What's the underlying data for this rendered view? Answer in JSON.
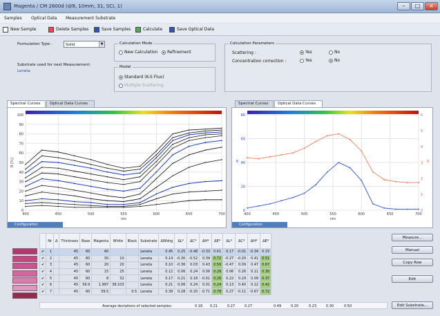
{
  "window": {
    "title": "Magenta / CM 2600d (d/8, 10mm, 31, SCI, 1)"
  },
  "menu": [
    "Samples",
    "Optical Data",
    "Measurement Substrate"
  ],
  "toolbar": {
    "new": "New Sample",
    "delete": "Delete Samples",
    "save": "Save Samples",
    "calculate": "Calculate",
    "save_optical": "Save Optical Data"
  },
  "form": {
    "formulation_label": "Formulation Type :",
    "formulation_value": "Solid",
    "substrate_label": "Substrate used for next Measurement:",
    "substrate_value": "Leneta",
    "calc_mode_title": "Calculation Mode",
    "calc_new": "New Calculation",
    "calc_refine": "Refinement",
    "model_title": "Model",
    "model_standard": "Standard (K-S Flux)",
    "model_other": "Multiple Scattering",
    "params_title": "Calculation Parameters",
    "scattering": "Scattering :",
    "concentration": "Concentration correction :",
    "yes": "Yes",
    "no": "No"
  },
  "left_tabs": [
    "Spectral Curves",
    "Optical Data Curves"
  ],
  "right_tabs": [
    "Spectral Curves",
    "Optical Data Curves"
  ],
  "config_label": "Configuration",
  "left_chart": {
    "ylabel": "R [%]",
    "xlabel": "nm",
    "yticks": [
      "0",
      "10",
      "20",
      "30",
      "40",
      "50",
      "60",
      "70",
      "80",
      "90",
      "100"
    ],
    "xticks": [
      "400",
      "450",
      "500",
      "550",
      "600",
      "650",
      "700"
    ]
  },
  "right_chart": {
    "ylabel": "K",
    "ylabel2": "S",
    "xlabel": "nm",
    "yticks": [
      "0",
      "20",
      "40",
      "60",
      "80"
    ],
    "y2ticks": [
      "0",
      "1",
      "2",
      "3",
      "4",
      "5",
      "6"
    ],
    "xticks": [
      "400",
      "450",
      "500",
      "550",
      "600",
      "650",
      "700"
    ]
  },
  "chart_data": [
    {
      "type": "line",
      "xlabel": "nm",
      "ylabel": "R [%]",
      "xlim": [
        400,
        700
      ],
      "ylim": [
        0,
        100
      ],
      "x": [
        400,
        425,
        450,
        475,
        500,
        525,
        550,
        575,
        600,
        625,
        650,
        675,
        700
      ],
      "series": [
        {
          "values": [
            48,
            63,
            61,
            57,
            53,
            48,
            44,
            46,
            62,
            80,
            84,
            85,
            86
          ]
        },
        {
          "values": [
            43,
            57,
            55,
            52,
            48,
            44,
            41,
            43,
            58,
            76,
            81,
            83,
            84
          ]
        },
        {
          "values": [
            39,
            51,
            50,
            47,
            44,
            40,
            37,
            39,
            55,
            73,
            79,
            81,
            82
          ]
        },
        {
          "values": [
            34,
            45,
            44,
            41,
            38,
            35,
            32,
            35,
            51,
            69,
            76,
            79,
            80
          ]
        },
        {
          "values": [
            30,
            39,
            38,
            35,
            32,
            29,
            27,
            30,
            47,
            65,
            73,
            76,
            78
          ]
        },
        {
          "values": [
            25,
            33,
            31,
            28,
            25,
            22,
            20,
            23,
            40,
            58,
            67,
            71,
            73
          ]
        },
        {
          "values": [
            20,
            26,
            24,
            21,
            18,
            15,
            13,
            17,
            33,
            49,
            58,
            63,
            66
          ]
        },
        {
          "values": [
            15,
            19,
            17,
            15,
            12,
            10,
            9,
            12,
            24,
            36,
            45,
            50,
            53
          ]
        },
        {
          "values": [
            10,
            12,
            11,
            9,
            8,
            6,
            6,
            8,
            17,
            24,
            28,
            30,
            31
          ]
        },
        {
          "values": [
            7,
            8,
            7,
            6,
            5,
            4,
            4,
            6,
            12,
            17,
            19,
            20,
            21
          ]
        },
        {
          "values": [
            4,
            5,
            4,
            3,
            3,
            3,
            3,
            4,
            6,
            8,
            10,
            11,
            11
          ]
        }
      ]
    },
    {
      "type": "line",
      "xlabel": "nm",
      "ylabel": "K",
      "xlim": [
        400,
        700
      ],
      "ylim": [
        0,
        90
      ],
      "x": [
        400,
        420,
        440,
        460,
        480,
        500,
        520,
        540,
        560,
        580,
        600,
        620,
        640,
        660,
        680,
        700
      ],
      "series": [
        {
          "name": "K",
          "values": [
            2,
            4,
            6,
            9,
            12,
            16,
            24,
            36,
            45,
            40,
            28,
            6,
            2,
            1,
            1,
            1
          ]
        },
        {
          "name": "S",
          "values": [
            5.5,
            5.4,
            5.6,
            5.8,
            6.0,
            6.5,
            7.2,
            7.8,
            8.0,
            7.4,
            6.2,
            4.0,
            3.2,
            3.0,
            2.9,
            2.9
          ]
        }
      ]
    }
  ],
  "table": {
    "headers": [
      "",
      "Nr",
      "Δ",
      "Thickness",
      "Base",
      "Magenta",
      "White",
      "Black",
      "Substrate",
      "ΔWdng",
      "ΔL*",
      "ΔC*",
      "ΔH*",
      "ΔE*",
      "ΔL*",
      "ΔC*",
      "ΔH*",
      "ΔE*"
    ],
    "rows": [
      {
        "nr": "1",
        "thick": "45",
        "base": "60",
        "mag": "40",
        "white": "",
        "black": "",
        "sub": "Leneta",
        "w": "0.45",
        "l1": "0.25",
        "c1": "-0.48",
        "h1": "-0.33",
        "e1": "0.61",
        "l2": "0.17",
        "c2": "-0.01",
        "h2": "-0.34",
        "e2": "0.33",
        "sel": true
      },
      {
        "nr": "2",
        "thick": "45",
        "base": "60",
        "mag": "30",
        "white": "10",
        "black": "",
        "sub": "Leneta",
        "w": "0.14",
        "l1": "-0.30",
        "c1": "-0.52",
        "h1": "0.39",
        "e1": "0.72",
        "l2": "-0.27",
        "c2": "-0.20",
        "h2": "0.41",
        "e2": "0.51",
        "sel": false
      },
      {
        "nr": "3",
        "thick": "45",
        "base": "60",
        "mag": "20",
        "white": "20",
        "black": "",
        "sub": "Leneta",
        "w": "0.10",
        "l1": "-0.36",
        "c1": "0.03",
        "h1": "0.43",
        "e1": "0.56",
        "l2": "-0.47",
        "c2": "0.09",
        "h2": "0.47",
        "e2": "0.67",
        "sel": false
      },
      {
        "nr": "4",
        "thick": "45",
        "base": "60",
        "mag": "15",
        "white": "25",
        "black": "",
        "sub": "Leneta",
        "w": "0.12",
        "l1": "0.06",
        "c1": "0.24",
        "h1": "0.06",
        "e1": "0.26",
        "l2": "0.06",
        "c2": "0.26",
        "h2": "0.11",
        "e2": "0.30",
        "sel": false
      },
      {
        "nr": "5",
        "thick": "45",
        "base": "60",
        "mag": "8",
        "white": "32",
        "black": "",
        "sub": "Leneta",
        "w": "0.17",
        "l1": "0.21",
        "c1": "0.18",
        "h1": "-0.01",
        "e1": "0.26",
        "l2": "0.22",
        "c2": "0.29",
        "h2": "0.09",
        "e2": "0.37",
        "sel": false
      },
      {
        "nr": "6",
        "thick": "45",
        "base": "59.9",
        "mag": "1.997",
        "white": "38.103",
        "black": "",
        "sub": "Leneta",
        "w": "0.21",
        "l1": "0.06",
        "c1": "0.24",
        "h1": "0.01",
        "e1": "0.24",
        "l2": "0.13",
        "c2": "0.40",
        "h2": "0.12",
        "e2": "0.42",
        "sel": false
      },
      {
        "nr": "7",
        "thick": "45",
        "base": "60",
        "mag": "39.5",
        "white": "",
        "black": "0.5",
        "sub": "Leneta",
        "w": "0.39",
        "l1": "0.28",
        "c1": "-0.20",
        "h1": "-0.71",
        "e1": "0.78",
        "l2": "0.27",
        "c2": "-0.11",
        "h2": "-0.67",
        "e2": "0.72",
        "sel": false
      }
    ],
    "footer_label": "Average deviations of selected samples:",
    "footer": [
      "0.18",
      "0.21",
      "0.27",
      "0.27",
      "0.49",
      "0.20",
      "0.23",
      "0.30",
      "0.50"
    ],
    "swatches": [
      "#b3376f",
      "#c24882",
      "#c95491",
      "#d066a0",
      "#d77db0",
      "#df99c0",
      "#8e2d4e"
    ]
  },
  "buttons": {
    "measure": "Measure...",
    "manual": "Manual",
    "copy": "Copy Row",
    "edit": "Edit",
    "edit_substrate": "Edit Substrate..."
  }
}
